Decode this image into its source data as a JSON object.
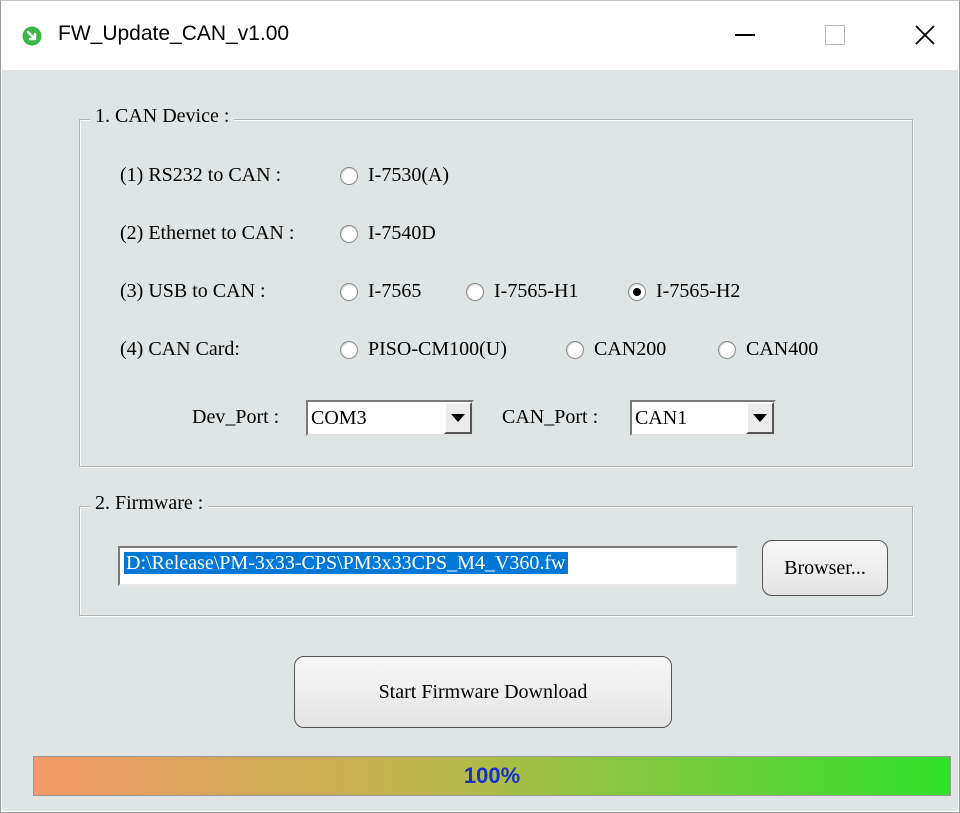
{
  "window": {
    "title": "FW_Update_CAN_v1.00",
    "icon": "green-circle-arrow-icon",
    "controls": [
      "minimize-icon",
      "maximize-icon",
      "close-icon"
    ]
  },
  "can_device": {
    "legend": "1. CAN Device :",
    "rows": [
      {
        "label": "(1) RS232 to CAN :",
        "options": [
          {
            "label": "I-7530(A)",
            "selected": false
          }
        ]
      },
      {
        "label": "(2) Ethernet to CAN :",
        "options": [
          {
            "label": "I-7540D",
            "selected": false
          }
        ]
      },
      {
        "label": "(3) USB to CAN :",
        "options": [
          {
            "label": "I-7565",
            "selected": false
          },
          {
            "label": "I-7565-H1",
            "selected": false
          },
          {
            "label": "I-7565-H2",
            "selected": true
          }
        ]
      },
      {
        "label": "(4) CAN Card:",
        "options": [
          {
            "label": "PISO-CM100(U)",
            "selected": false
          },
          {
            "label": "CAN200",
            "selected": false
          },
          {
            "label": "CAN400",
            "selected": false
          }
        ]
      }
    ],
    "dev_port": {
      "label": "Dev_Port :",
      "value": "COM3"
    },
    "can_port": {
      "label": "CAN_Port :",
      "value": "CAN1"
    }
  },
  "firmware": {
    "legend": "2. Firmware :",
    "path": "D:\\Release\\PM-3x33-CPS\\PM3x33CPS_M4_V360.fw",
    "browse_label": "Browser..."
  },
  "start_label": "Start Firmware Download",
  "progress": {
    "percent": 100,
    "text": "100%"
  },
  "colors": {
    "client_bg": "#dfe4e4",
    "selection": "#0078d7",
    "progress_text": "#1530cc",
    "progress_start": "#f39a6a",
    "progress_end": "#2fe02a"
  }
}
